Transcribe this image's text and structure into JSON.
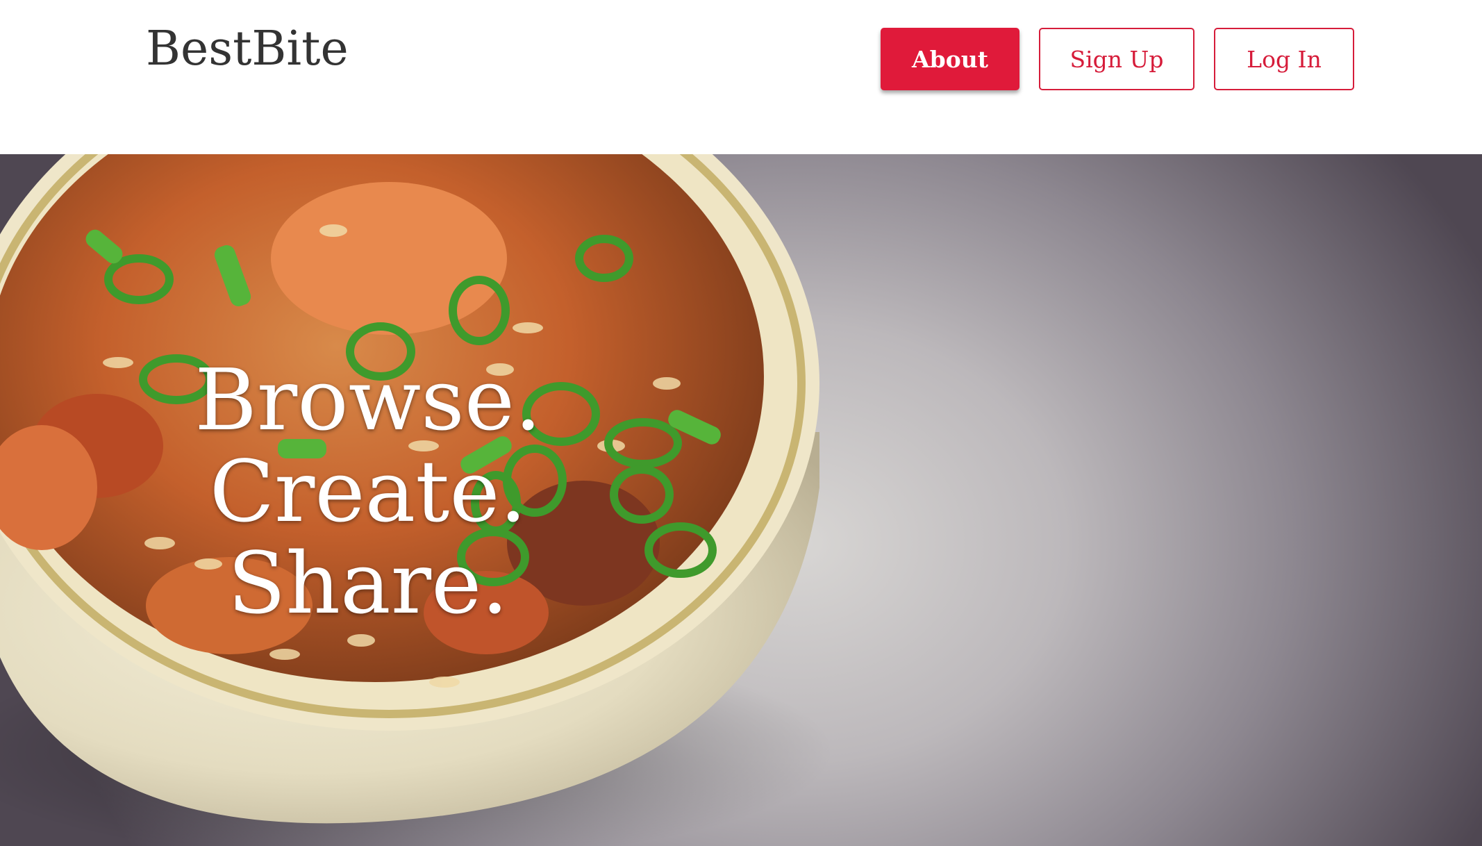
{
  "brand": {
    "name": "BestBite"
  },
  "nav": {
    "about_label": "About",
    "signup_label": "Sign Up",
    "login_label": "Log In"
  },
  "hero": {
    "line1": "Browse.",
    "line2": "Create.",
    "line3": "Share."
  },
  "colors": {
    "accent": "#e01a3a",
    "logo_text": "#333333"
  }
}
